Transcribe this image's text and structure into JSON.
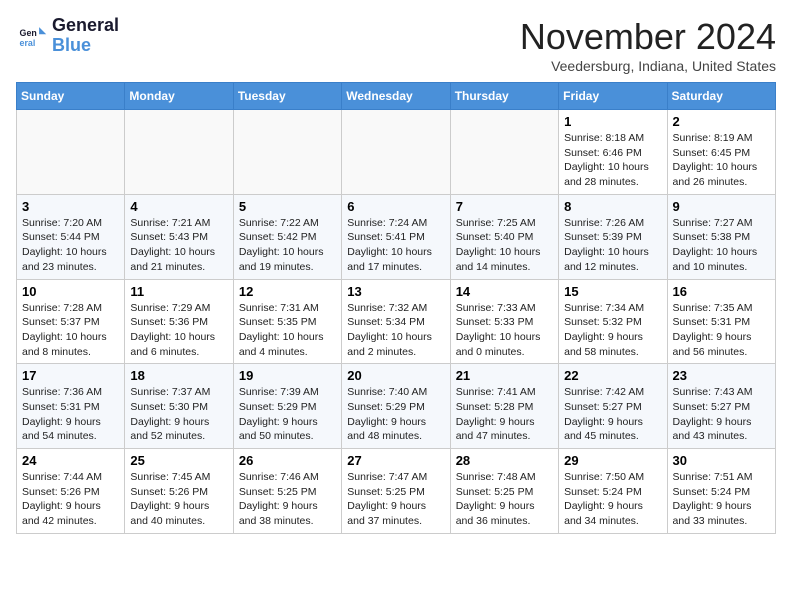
{
  "logo": {
    "line1": "General",
    "line2": "Blue"
  },
  "header": {
    "month": "November 2024",
    "location": "Veedersburg, Indiana, United States"
  },
  "weekdays": [
    "Sunday",
    "Monday",
    "Tuesday",
    "Wednesday",
    "Thursday",
    "Friday",
    "Saturday"
  ],
  "weeks": [
    [
      {
        "day": "",
        "info": ""
      },
      {
        "day": "",
        "info": ""
      },
      {
        "day": "",
        "info": ""
      },
      {
        "day": "",
        "info": ""
      },
      {
        "day": "",
        "info": ""
      },
      {
        "day": "1",
        "info": "Sunrise: 8:18 AM\nSunset: 6:46 PM\nDaylight: 10 hours and 28 minutes."
      },
      {
        "day": "2",
        "info": "Sunrise: 8:19 AM\nSunset: 6:45 PM\nDaylight: 10 hours and 26 minutes."
      }
    ],
    [
      {
        "day": "3",
        "info": "Sunrise: 7:20 AM\nSunset: 5:44 PM\nDaylight: 10 hours and 23 minutes."
      },
      {
        "day": "4",
        "info": "Sunrise: 7:21 AM\nSunset: 5:43 PM\nDaylight: 10 hours and 21 minutes."
      },
      {
        "day": "5",
        "info": "Sunrise: 7:22 AM\nSunset: 5:42 PM\nDaylight: 10 hours and 19 minutes."
      },
      {
        "day": "6",
        "info": "Sunrise: 7:24 AM\nSunset: 5:41 PM\nDaylight: 10 hours and 17 minutes."
      },
      {
        "day": "7",
        "info": "Sunrise: 7:25 AM\nSunset: 5:40 PM\nDaylight: 10 hours and 14 minutes."
      },
      {
        "day": "8",
        "info": "Sunrise: 7:26 AM\nSunset: 5:39 PM\nDaylight: 10 hours and 12 minutes."
      },
      {
        "day": "9",
        "info": "Sunrise: 7:27 AM\nSunset: 5:38 PM\nDaylight: 10 hours and 10 minutes."
      }
    ],
    [
      {
        "day": "10",
        "info": "Sunrise: 7:28 AM\nSunset: 5:37 PM\nDaylight: 10 hours and 8 minutes."
      },
      {
        "day": "11",
        "info": "Sunrise: 7:29 AM\nSunset: 5:36 PM\nDaylight: 10 hours and 6 minutes."
      },
      {
        "day": "12",
        "info": "Sunrise: 7:31 AM\nSunset: 5:35 PM\nDaylight: 10 hours and 4 minutes."
      },
      {
        "day": "13",
        "info": "Sunrise: 7:32 AM\nSunset: 5:34 PM\nDaylight: 10 hours and 2 minutes."
      },
      {
        "day": "14",
        "info": "Sunrise: 7:33 AM\nSunset: 5:33 PM\nDaylight: 10 hours and 0 minutes."
      },
      {
        "day": "15",
        "info": "Sunrise: 7:34 AM\nSunset: 5:32 PM\nDaylight: 9 hours and 58 minutes."
      },
      {
        "day": "16",
        "info": "Sunrise: 7:35 AM\nSunset: 5:31 PM\nDaylight: 9 hours and 56 minutes."
      }
    ],
    [
      {
        "day": "17",
        "info": "Sunrise: 7:36 AM\nSunset: 5:31 PM\nDaylight: 9 hours and 54 minutes."
      },
      {
        "day": "18",
        "info": "Sunrise: 7:37 AM\nSunset: 5:30 PM\nDaylight: 9 hours and 52 minutes."
      },
      {
        "day": "19",
        "info": "Sunrise: 7:39 AM\nSunset: 5:29 PM\nDaylight: 9 hours and 50 minutes."
      },
      {
        "day": "20",
        "info": "Sunrise: 7:40 AM\nSunset: 5:29 PM\nDaylight: 9 hours and 48 minutes."
      },
      {
        "day": "21",
        "info": "Sunrise: 7:41 AM\nSunset: 5:28 PM\nDaylight: 9 hours and 47 minutes."
      },
      {
        "day": "22",
        "info": "Sunrise: 7:42 AM\nSunset: 5:27 PM\nDaylight: 9 hours and 45 minutes."
      },
      {
        "day": "23",
        "info": "Sunrise: 7:43 AM\nSunset: 5:27 PM\nDaylight: 9 hours and 43 minutes."
      }
    ],
    [
      {
        "day": "24",
        "info": "Sunrise: 7:44 AM\nSunset: 5:26 PM\nDaylight: 9 hours and 42 minutes."
      },
      {
        "day": "25",
        "info": "Sunrise: 7:45 AM\nSunset: 5:26 PM\nDaylight: 9 hours and 40 minutes."
      },
      {
        "day": "26",
        "info": "Sunrise: 7:46 AM\nSunset: 5:25 PM\nDaylight: 9 hours and 38 minutes."
      },
      {
        "day": "27",
        "info": "Sunrise: 7:47 AM\nSunset: 5:25 PM\nDaylight: 9 hours and 37 minutes."
      },
      {
        "day": "28",
        "info": "Sunrise: 7:48 AM\nSunset: 5:25 PM\nDaylight: 9 hours and 36 minutes."
      },
      {
        "day": "29",
        "info": "Sunrise: 7:50 AM\nSunset: 5:24 PM\nDaylight: 9 hours and 34 minutes."
      },
      {
        "day": "30",
        "info": "Sunrise: 7:51 AM\nSunset: 5:24 PM\nDaylight: 9 hours and 33 minutes."
      }
    ]
  ]
}
